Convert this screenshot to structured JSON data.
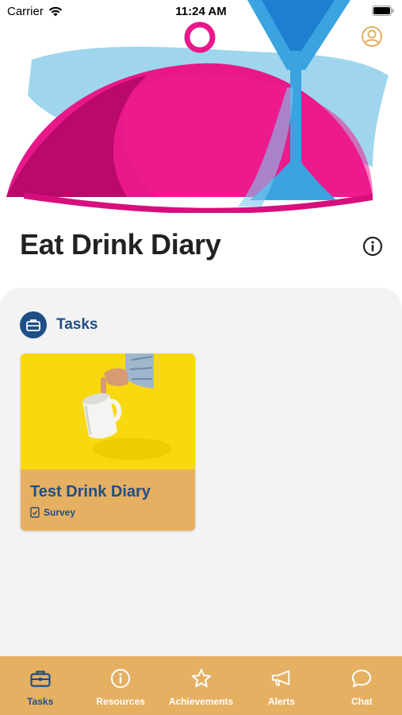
{
  "status_bar": {
    "carrier": "Carrier",
    "time": "11:24 AM"
  },
  "header": {
    "title": "Eat Drink Diary"
  },
  "section": {
    "title": "Tasks"
  },
  "tasks": [
    {
      "title": "Test Drink Diary",
      "type": "Survey"
    }
  ],
  "tabbar": {
    "tabs": [
      {
        "label": "Tasks",
        "icon": "briefcase-icon",
        "active": true
      },
      {
        "label": "Resources",
        "icon": "info-icon",
        "active": false
      },
      {
        "label": "Achievements",
        "icon": "star-icon",
        "active": false
      },
      {
        "label": "Alerts",
        "icon": "megaphone-icon",
        "active": false
      },
      {
        "label": "Chat",
        "icon": "chat-bubble-icon",
        "active": false
      }
    ]
  },
  "colors": {
    "primary": "#1f4e86",
    "accent": "#e5b062",
    "cloche": "#e8178a",
    "glass": "#3aa3e0",
    "card_image_bg": "#f8d90f"
  }
}
